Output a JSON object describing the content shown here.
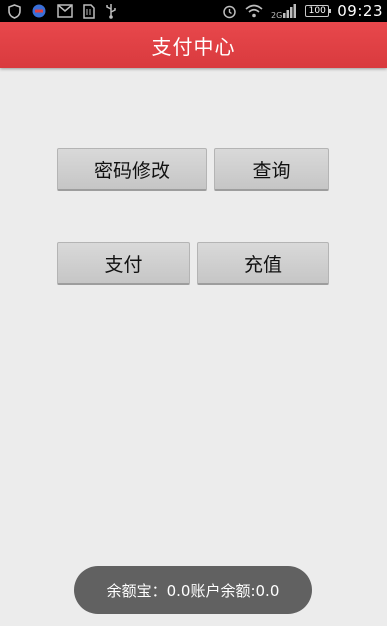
{
  "status_bar": {
    "time": "09:23",
    "battery_level": "100",
    "network_label": "2G",
    "icons": [
      "shield-icon",
      "notification-icon",
      "sms-icon",
      "sim-icon",
      "usb-icon",
      "alarm-icon",
      "wifi-icon",
      "signal-icon",
      "battery-icon"
    ]
  },
  "header": {
    "title": "支付中心",
    "background_color": "#e2434a"
  },
  "buttons": {
    "change_password": "密码修改",
    "query": "查询",
    "pay": "支付",
    "recharge": "充值"
  },
  "toast": {
    "text": "余额宝：0.0账户余额:0.0"
  }
}
